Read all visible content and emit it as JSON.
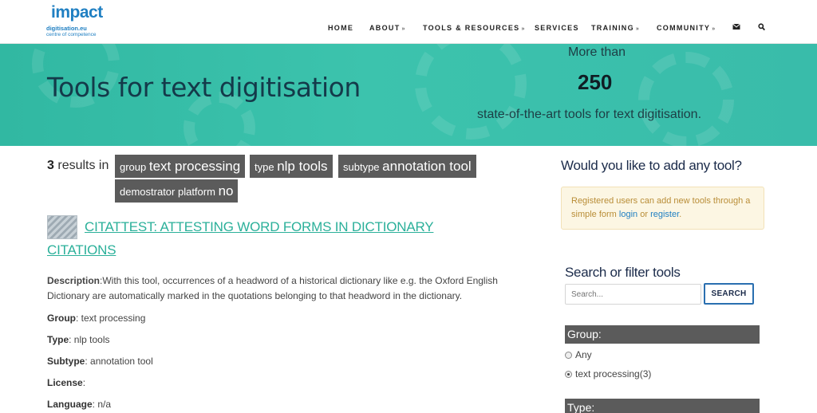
{
  "logo": {
    "line1": "impact",
    "line2": "digitisation.eu",
    "line3": "centre of competence"
  },
  "nav": {
    "items": [
      {
        "label": "HOME"
      },
      {
        "label": "ABOUT",
        "chevron": "»"
      },
      {
        "label": "TOOLS & RESOURCES",
        "chevron": "»"
      },
      {
        "label": "SERVICES"
      },
      {
        "label": "TRAINING",
        "chevron": "»"
      },
      {
        "label": "COMMUNITY",
        "chevron": "»"
      }
    ],
    "mail_icon": "✉",
    "search_icon": "🔍"
  },
  "banner": {
    "title": "Tools for text digitisation",
    "more_than": "More than",
    "count": "250",
    "subtitle": "state-of-the-art tools for text digitisation."
  },
  "results": {
    "count": "3",
    "text": "results in",
    "tags": [
      {
        "key": "group",
        "value": "text processing"
      },
      {
        "key": "type",
        "value": "nlp tools"
      },
      {
        "key": "subtype",
        "value": "annotation tool"
      },
      {
        "key": "demostrator platform",
        "value": "no"
      }
    ]
  },
  "tool": {
    "title": "CITATTEST: ATTESTING WORD FORMS IN DICTIONARY CITATIONS",
    "description_label": "Description",
    "description": "With this tool, occurrences of a headword of a historical dictionary like e.g. the Oxford English Dictionary are automatically marked in the quotations belonging to that headword in the dictionary.",
    "group_label": "Group",
    "group": "text processing",
    "type_label": "Type",
    "type": "nlp tools",
    "subtype_label": "Subtype",
    "subtype": "annotation tool",
    "license_label": "License",
    "license": "",
    "language_label": "Language",
    "language": "n/a"
  },
  "sidebar": {
    "add_title": "Would you like to add any tool?",
    "alert_text": "Registered users can add new tools through a simple form",
    "login": "login",
    "or": "or",
    "register": "register",
    "search_title": "Search or filter tools",
    "search_placeholder": "Search...",
    "search_button": "SEARCH",
    "group_title": "Group:",
    "group_options": [
      {
        "label": "Any",
        "checked": false
      },
      {
        "label": "text processing(3)",
        "checked": true
      }
    ],
    "type_title": "Type:"
  },
  "colors": {
    "accent": "#2bb09a",
    "banner": "#3cc3ad",
    "tag_bg": "#5b5b5b",
    "brand": "#1f7fc2"
  }
}
